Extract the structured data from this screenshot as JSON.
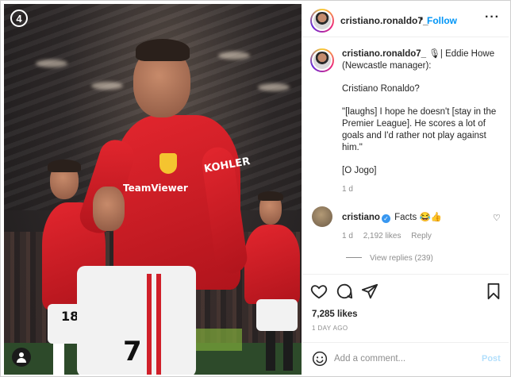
{
  "photo": {
    "index_badge": "4",
    "sponsor_text": "KOHLER",
    "chest_sponsor": "TeamViewer",
    "shirt_number": "7",
    "left_number": "18"
  },
  "header": {
    "username": "cristiano.ronaldo7_",
    "dot": "•",
    "follow_label": "Follow",
    "more_label": "···"
  },
  "caption": {
    "username": "cristiano.ronaldo7_",
    "paragraphs": [
      "🎙| Eddie Howe (Newcastle manager):",
      "Cristiano Ronaldo?",
      "\"[laughs] I hope he doesn't [stay in the Premier League]. He scores a lot of goals and I'd rather not play against him.\"",
      "[O Jogo]"
    ],
    "timestamp": "1 d"
  },
  "comment": {
    "username": "cristiano",
    "text": "Facts 😂👍",
    "time": "1 d",
    "likes": "2,192 likes",
    "reply_label": "Reply",
    "view_replies": "View replies (239)"
  },
  "actions": {
    "likes": "7,285 likes",
    "time_ago": "1 DAY AGO"
  },
  "add_comment": {
    "placeholder": "Add a comment...",
    "post_label": "Post"
  },
  "colors": {
    "accent": "#0095f6",
    "post_disabled": "#b2dffc",
    "verified": "#3897f0"
  }
}
